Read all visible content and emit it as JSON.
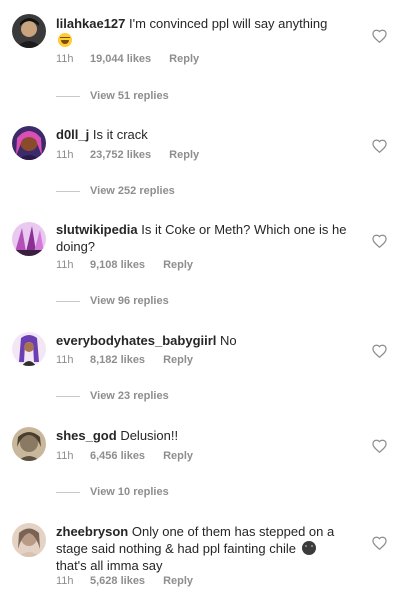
{
  "comments": [
    {
      "username": "lilahkae127",
      "text": "I'm convinced ppl will say anything",
      "emoji": "face-with-tears-of-joy",
      "time": "11h",
      "likes": "19,044 likes",
      "reply": "Reply",
      "view_replies": "View 51 replies",
      "avatar_colors": [
        "#2b2b2b",
        "#c9a27e"
      ]
    },
    {
      "username": "d0ll_j",
      "text": "Is it crack",
      "time": "11h",
      "likes": "23,752 likes",
      "reply": "Reply",
      "view_replies": "View 252 replies",
      "avatar_colors": [
        "#3d2a6b",
        "#d94fb5"
      ]
    },
    {
      "username": "slutwikipedia",
      "text": "Is it Coke or Meth? Which one is he doing?",
      "time": "11h",
      "likes": "9,108 likes",
      "reply": "Reply",
      "view_replies": "View 96 replies",
      "avatar_colors": [
        "#e9c9ef",
        "#b34fb8"
      ]
    },
    {
      "username": "everybodyhates_babygiirl",
      "text": "No",
      "time": "11h",
      "likes": "8,182 likes",
      "reply": "Reply",
      "view_replies": "View 23 replies",
      "avatar_colors": [
        "#f3e6f5",
        "#6a3fb2"
      ]
    },
    {
      "username": "shes_god",
      "text": "Delusion!!",
      "time": "11h",
      "likes": "6,456 likes",
      "reply": "Reply",
      "view_replies": "View 10 replies",
      "avatar_colors": [
        "#8a7a63",
        "#c8b79a"
      ]
    },
    {
      "username": "zheebryson",
      "text": "Only one of them has stepped on a stage said nothing & had ppl fainting chile",
      "text_after_emoji": "that's all imma say",
      "emoji": "dark-face",
      "time": "11h",
      "likes": "5,628 likes",
      "reply": "Reply",
      "avatar_colors": [
        "#b89c88",
        "#e4d2c4"
      ]
    }
  ],
  "icons": {
    "like": "heart-outline-icon"
  }
}
